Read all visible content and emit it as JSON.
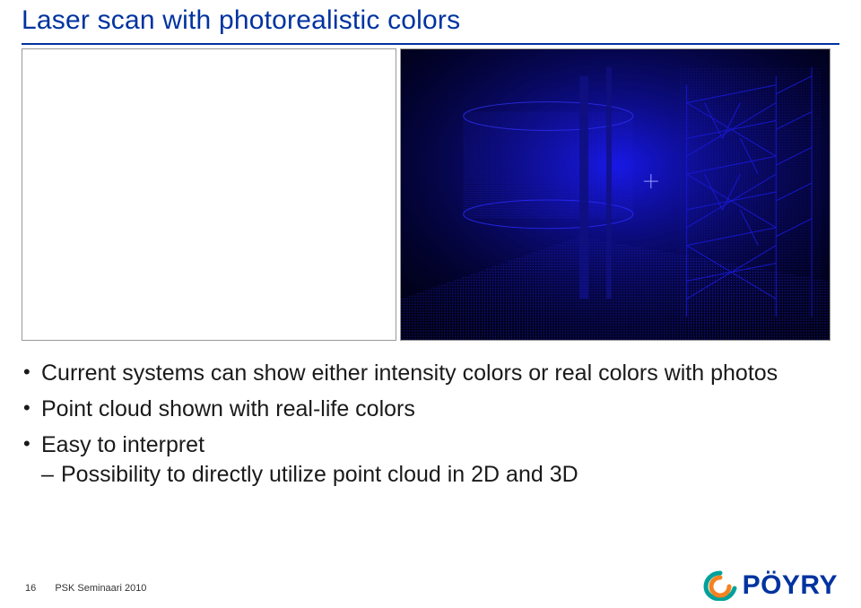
{
  "title": "Laser scan with photorealistic colors",
  "bullets": {
    "items": [
      "Current systems can show either intensity colors or real colors with photos",
      "Point cloud shown with real-life colors",
      "Easy to interpret"
    ],
    "sub_of_2": [
      "Possibility to directly utilize point cloud in 2D and 3D"
    ]
  },
  "footer": {
    "page_number": "16",
    "event": "PSK Seminaari 2010"
  },
  "logo": {
    "name": "PÖYRY",
    "swirl_colors": {
      "outer": "#00a19a",
      "inner": "#f58220"
    }
  },
  "images": {
    "left_alt": "empty-white-panel",
    "right_alt": "laser-scan-point-cloud-blue"
  }
}
